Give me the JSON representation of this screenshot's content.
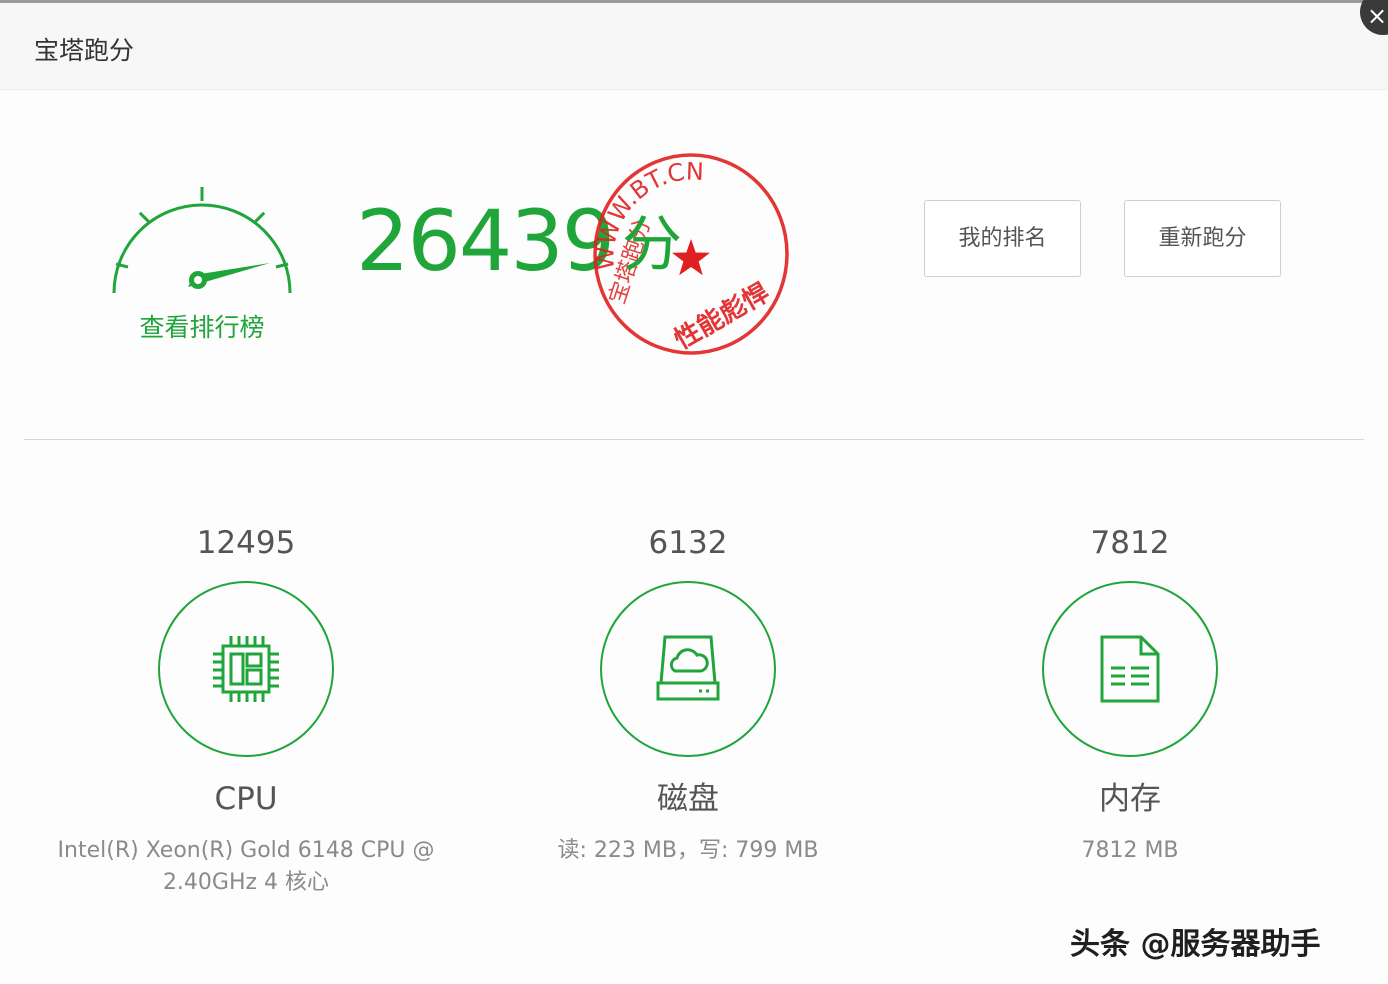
{
  "window": {
    "title": "宝塔跑分",
    "close_icon": "×"
  },
  "summary": {
    "score": "26439",
    "unit": "分",
    "leaderboard_link": "查看排行榜",
    "gauge_icon": "speedometer-icon",
    "seal_icon": "stamp-seal-icon",
    "seal_text_lines": [
      "WWW.BT.CN",
      "宝塔跑分",
      "性能彪悍"
    ]
  },
  "buttons": {
    "my_rank": "我的排名",
    "rerun": "重新跑分"
  },
  "items": [
    {
      "score": "12495",
      "name": "CPU",
      "desc": "Intel(R) Xeon(R) Gold 6148 CPU @ 2.40GHz 4 核心",
      "icon": "cpu-chip-icon"
    },
    {
      "score": "6132",
      "name": "磁盘",
      "desc": "读: 223 MB，写: 799 MB",
      "icon": "disk-cloud-icon"
    },
    {
      "score": "7812",
      "name": "内存",
      "desc": "7812 MB",
      "icon": "memory-document-icon"
    }
  ],
  "watermark": "头条 @服务器助手",
  "colors": {
    "accent_green": "#20a53a",
    "seal_red": "#e02020",
    "text_gray": "#555555"
  }
}
